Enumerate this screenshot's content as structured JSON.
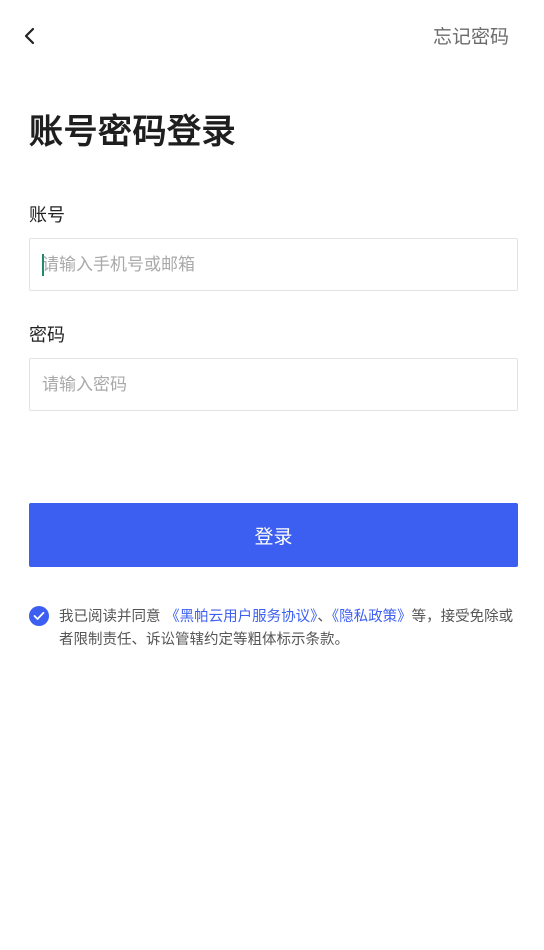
{
  "header": {
    "back_icon": "chevron-left-icon",
    "forgot_password": "忘记密码"
  },
  "title": "账号密码登录",
  "form": {
    "account": {
      "label": "账号",
      "placeholder": "请输入手机号或邮箱",
      "value": ""
    },
    "password": {
      "label": "密码",
      "placeholder": "请输入密码",
      "value": ""
    },
    "submit_label": "登录"
  },
  "agreement": {
    "checked": true,
    "prefix": "我已阅读并同意 ",
    "user_agreement": "《黑帕云用户服务协议》",
    "separator": "、",
    "privacy_policy": "《隐私政策》",
    "suffix": "等，接受免除或者限制责任、诉讼管辖约定等粗体标示条款。"
  },
  "colors": {
    "primary": "#3d5ff1",
    "caret": "#1f8a70",
    "title_text": "#1e1e1e",
    "secondary_text": "#6b6b6b",
    "placeholder": "#a9a9a9",
    "border": "#e3e3e3"
  }
}
